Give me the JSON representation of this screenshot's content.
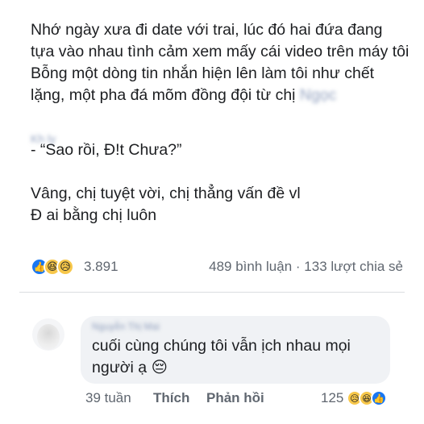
{
  "post": {
    "paragraph_1": "Nhớ ngày xưa đi date với trai, lúc đó hai đứa đang tựa vào nhau tình cảm xem mấy cái video trên máy tôi",
    "paragraph_2": "Bỗng một dòng tin nhắn hiện lên làm tôi như chết lặng, một pha đá mõm đồng đội từ chị",
    "quote": "- “Sao rồi, Đ!t Chưa?”",
    "line_1": "Vâng, chị tuyệt vời, chị thẳng vấn đề vl",
    "line_2": "Đ ai bằng chị luôn"
  },
  "reactions": {
    "count": "3.891",
    "comments": "489 bình luận",
    "separator": "·",
    "shares": "133 lượt chia sẻ",
    "icons": [
      "like-icon",
      "haha-icon",
      "sad-icon"
    ]
  },
  "comment": {
    "text": "cuối cùng chúng tôi vẫn ịch nhau mọi người ạ",
    "emoji": "😔",
    "time": "39 tuần",
    "like_label": "Thích",
    "reply_label": "Phản hồi",
    "reaction_count": "125",
    "reaction_icons": [
      "sad-icon",
      "haha-icon",
      "like-icon"
    ]
  },
  "colors": {
    "like_blue": "#1877f2",
    "bubble_bg": "#f0f2f5",
    "meta_gray": "#606770"
  }
}
